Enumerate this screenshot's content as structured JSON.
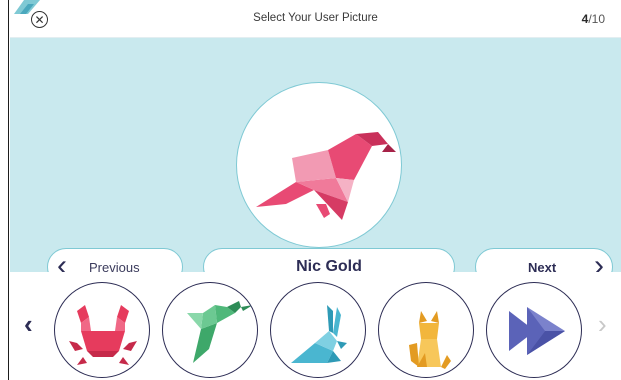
{
  "header": {
    "title": "Select Your User Picture",
    "progress_current": "4",
    "progress_total": "/10",
    "close_icon": "close-circle-icon"
  },
  "selected": {
    "name": "Nic Gold",
    "icon": "origami-bird-icon",
    "accent": "#e84a74"
  },
  "nav": {
    "previous_label": "Previous",
    "next_label": "Next"
  },
  "carousel": {
    "left_arrow": "‹",
    "right_arrow": "›",
    "items": [
      {
        "icon": "origami-crab-icon",
        "color": "#e63b5d"
      },
      {
        "icon": "origami-hummingbird-icon",
        "color": "#4fb87a"
      },
      {
        "icon": "origami-rabbit-icon",
        "color": "#4ab6d0"
      },
      {
        "icon": "origami-cat-icon",
        "color": "#f2b63c"
      },
      {
        "icon": "origami-fish-icon",
        "color": "#5b63b8"
      }
    ]
  },
  "colors": {
    "stage_bg": "#c9e9ee",
    "outline": "#7fc9d4",
    "text_dark": "#2d2d55"
  }
}
